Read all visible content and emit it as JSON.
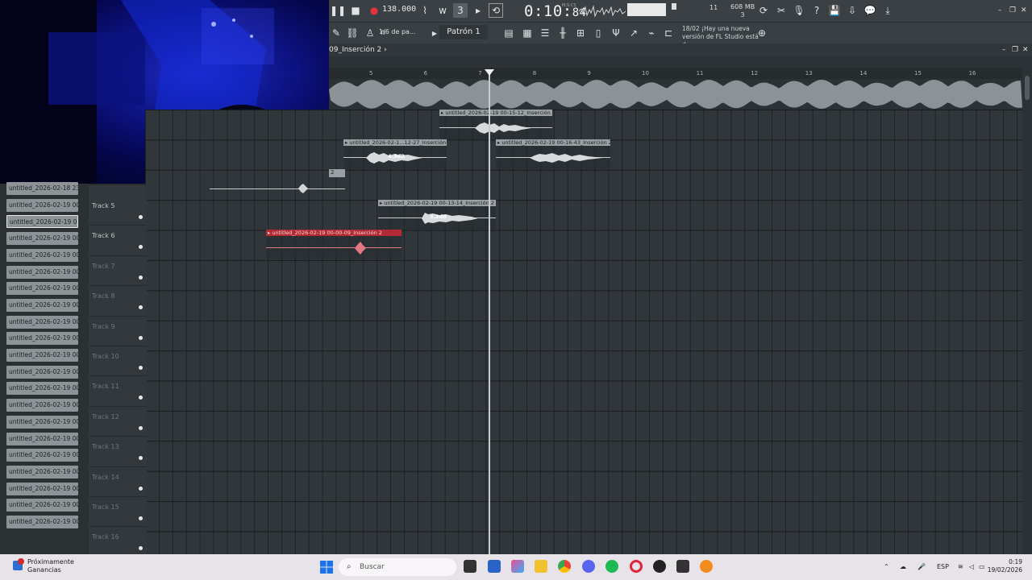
{
  "transport": {
    "tempo": "138.000",
    "time_main": "0:10",
    "time_sub": "84",
    "time_unit": "M:S:CS",
    "cpu_label": "11",
    "memory": "608 MB",
    "memory_sub": "3"
  },
  "toolbar2": {
    "snap": "1/6 de pa...",
    "pattern": "Patrón 1",
    "news_date": "18/02",
    "news_text": "¡Hay una nueva versión de FL Studio está d..."
  },
  "playlist": {
    "title": "09_Inserción 2 ›",
    "ruler": [
      "5",
      "6",
      "7",
      "8",
      "9",
      "10",
      "11",
      "12",
      "13",
      "14",
      "15",
      "16"
    ],
    "partial_label": "2"
  },
  "tracks": [
    {
      "name": "Track 5",
      "dim": false
    },
    {
      "name": "Track 6",
      "dim": false
    },
    {
      "name": "Track 7",
      "dim": true
    },
    {
      "name": "Track 8",
      "dim": true
    },
    {
      "name": "Track 9",
      "dim": true
    },
    {
      "name": "Track 10",
      "dim": true
    },
    {
      "name": "Track 11",
      "dim": true
    },
    {
      "name": "Track 12",
      "dim": true
    },
    {
      "name": "Track 13",
      "dim": true
    },
    {
      "name": "Track 14",
      "dim": true
    },
    {
      "name": "Track 15",
      "dim": true
    },
    {
      "name": "Track 16",
      "dim": true
    }
  ],
  "picker": [
    "untitled_2026-02-18 23-...",
    "untitled_2026-02-19 00-...",
    "untitled_2026-02-19 00-...",
    "untitled_2026-02-19 00-...",
    "untitled_2026-02-19 00-...",
    "untitled_2026-02-19 00-...",
    "untitled_2026-02-19 00-...",
    "untitled_2026-02-19 00-...",
    "untitled_2026-02-19 00-...",
    "untitled_2026-02-19 00-...",
    "untitled_2026-02-19 00-...",
    "untitled_2026-02-19 00-...",
    "untitled_2026-02-19 00-...",
    "untitled_2026-02-19 00-...",
    "untitled_2026-02-19 00-...",
    "untitled_2026-02-19 00-...",
    "untitled_2026-02-19 00-...",
    "untitled_2026-02-19 00-...",
    "untitled_2026-02-19 00-...",
    "untitled_2026-02-19 00-...",
    "untitled_2026-02-19 00-..."
  ],
  "clips": {
    "c1": "untitled_2026-02-19 00-15-12_Inserción 2",
    "c2": "untitled_2026-02-1...12-27_Inserción 2",
    "c2_gain": "4.3dB",
    "c3": "untitled_2026-02-19 00-16-43_Inserción 2",
    "c4": "untitled_2026-02-19 00-13-14_Inserción 2",
    "c4_gain": "3.2dB",
    "c5": "untitled_2026-02-19 00-00-09_Inserción 2"
  },
  "taskbar": {
    "weather_title": "Próximamente",
    "weather_sub": "Ganancias",
    "search_placeholder": "Buscar",
    "lang": "ESP",
    "time": "0:19",
    "date": "19/02/2026"
  }
}
